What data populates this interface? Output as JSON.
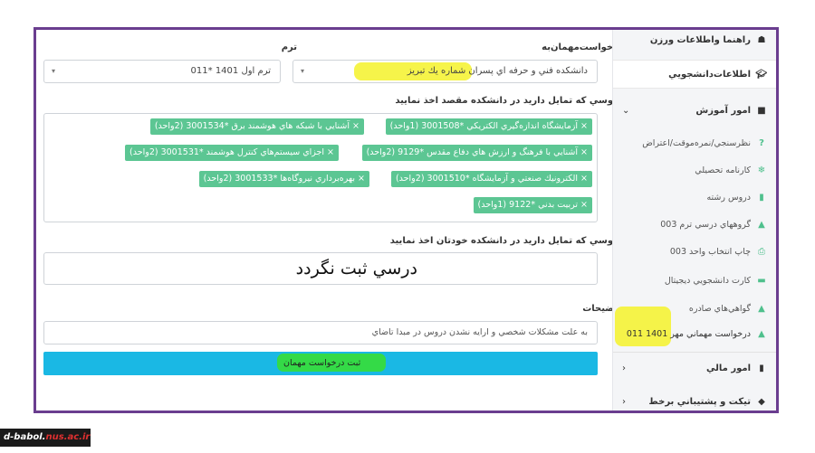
{
  "form": {
    "request_label": "درخواست‌مهمان‌به",
    "term_label": "ترم",
    "school_value": "دانشکده فني و حرفه اي پسران شماره يك تبريز",
    "term_value": "ترم اول 1401 *011",
    "dest_courses_label": "دروسي که تمايل داريد در دانشکده مقصد اخذ نماييد",
    "dest_courses": [
      "× آزمايشگاه اندازه‌گيري الكتريكي *3001508 (1واحد)",
      "× آشنايي با شبكه هاي هوشمند برق *3001534 (2واحد)",
      "× آشنايي با فرهنگ و ارزش هاي دفاع مقدس *9129 (2واحد)",
      "× اجزاي سيستم‌هاي کنترل هوشمند *3001531 (2واحد)",
      "× الكترونيك صنعتي و آزمايشگاه *3001510 (2واحد)",
      "× بهره‌برداري نيروگاه‌ها *3001533 (2واحد)",
      "× تربيت بدني *9122 (1واحد)"
    ],
    "own_courses_label": "دروسي که تمايل داريد در دانشکده خودتان اخذ نماييد",
    "own_courses_value": "درسي  ثبت نگردد",
    "notes_label": "توضيحات",
    "notes_value": "به علت مشكلات شخصي و ارايه نشدن دروس در مبدا تاضاي",
    "submit_label": "ثبت درخواست مهمان"
  },
  "sidebar": {
    "items": [
      {
        "label": "راهنما واطلاعات ورزن",
        "icon": "sitemap-icon",
        "main": true
      },
      {
        "label": "اطلاعات‌دانشجويي",
        "icon": "graduation-cap-icon",
        "main": true
      },
      {
        "label": "امور آموزش",
        "icon": "book-icon",
        "main": true
      },
      {
        "label": "نظرسنجي/نمره‌موقت/اعتراض",
        "icon": "question-icon"
      },
      {
        "label": "کارنامه تحصيلي",
        "icon": "snowflake-icon"
      },
      {
        "label": "دروس رشته",
        "icon": "bookmark-icon"
      },
      {
        "label": "گروههاي درسي ترم 003",
        "icon": "bell-icon"
      },
      {
        "label": "چاپ انتخاب واحد 003",
        "icon": "print-icon"
      },
      {
        "label": "کارت دانشجويي ديجيتال",
        "icon": "card-icon"
      },
      {
        "label": "گواهي‌هاي صادره",
        "icon": "bell-icon"
      },
      {
        "label": "درخواست مهماني مهر 1401 011",
        "icon": "bell-icon"
      },
      {
        "label": "امور مالي",
        "icon": "file-icon",
        "main": true
      },
      {
        "label": "تيکت و پشتيباني برخط",
        "icon": "tag-icon",
        "main": true
      }
    ]
  },
  "watermark": {
    "prefix": "d-babol.",
    "suffix": "nus.ac.ir"
  },
  "colors": {
    "frame": "#6a3d8f",
    "tag": "#5cc693",
    "submit": "#1ab8e4",
    "highlight_yellow": "#f4f22a",
    "highlight_green": "#3adf2c"
  }
}
